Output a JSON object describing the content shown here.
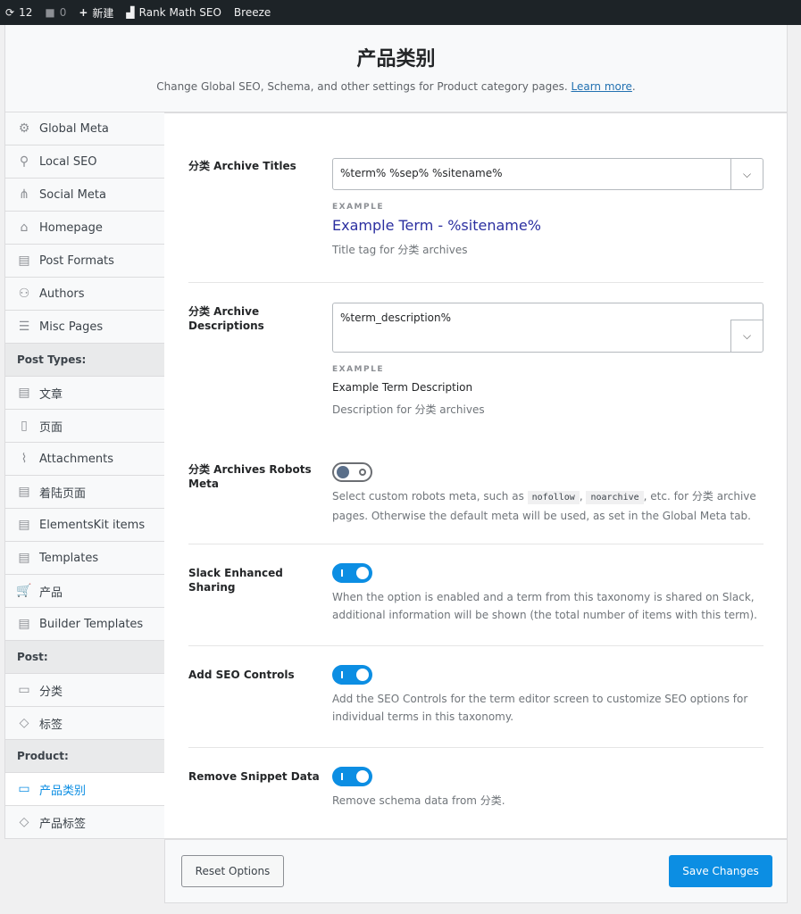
{
  "topbar": {
    "updates": "12",
    "comments": "0",
    "new": "新建",
    "rankmath": "Rank Math SEO",
    "breeze": "Breeze"
  },
  "header": {
    "title": "产品类别",
    "subtitle": "Change Global SEO, Schema, and other settings for Product category pages.",
    "learn_more": "Learn more",
    "period": "."
  },
  "sidebar": {
    "items": [
      {
        "label": "Global Meta",
        "icon": "⚙"
      },
      {
        "label": "Local SEO",
        "icon": "⚲"
      },
      {
        "label": "Social Meta",
        "icon": "⋔"
      },
      {
        "label": "Homepage",
        "icon": "⌂"
      },
      {
        "label": "Post Formats",
        "icon": "▤"
      },
      {
        "label": "Authors",
        "icon": "⚇"
      },
      {
        "label": "Misc Pages",
        "icon": "☰"
      },
      {
        "label": "Post Types:",
        "header": true
      },
      {
        "label": "文章",
        "icon": "▤"
      },
      {
        "label": "页面",
        "icon": "▯"
      },
      {
        "label": "Attachments",
        "icon": "⌇"
      },
      {
        "label": "着陆页面",
        "icon": "▤"
      },
      {
        "label": "ElementsKit items",
        "icon": "▤"
      },
      {
        "label": "Templates",
        "icon": "▤"
      },
      {
        "label": "产品",
        "icon": "🛒"
      },
      {
        "label": "Builder Templates",
        "icon": "▤"
      },
      {
        "label": "Post:",
        "header": true
      },
      {
        "label": "分类",
        "icon": "▭"
      },
      {
        "label": "标签",
        "icon": "◇"
      },
      {
        "label": "Product:",
        "header": true
      },
      {
        "label": "产品类别",
        "icon": "▭",
        "active": true
      },
      {
        "label": "产品标签",
        "icon": "◇"
      }
    ]
  },
  "settings": {
    "titles": {
      "label": "分类 Archive Titles",
      "value": "%term% %sep% %sitename%",
      "example_label": "EXAMPLE",
      "example": "Example Term - %sitename%",
      "desc": "Title tag for 分类 archives"
    },
    "descriptions": {
      "label": "分类 Archive Descriptions",
      "value": "%term_description%",
      "example_label": "EXAMPLE",
      "example": "Example Term Description",
      "desc": "Description for 分类 archives"
    },
    "robots": {
      "label": "分类 Archives Robots Meta",
      "enabled": false,
      "desc_a": "Select custom robots meta, such as ",
      "code1": "nofollow",
      "sep": ", ",
      "code2": "noarchive",
      "desc_b": ", etc. for 分类 archive pages. Otherwise the default meta will be used, as set in the Global Meta tab."
    },
    "slack": {
      "label": "Slack Enhanced Sharing",
      "enabled": true,
      "desc": "When the option is enabled and a term from this taxonomy is shared on Slack, additional information will be shown (the total number of items with this term)."
    },
    "seo_controls": {
      "label": "Add SEO Controls",
      "enabled": true,
      "desc": "Add the SEO Controls for the term editor screen to customize SEO options for individual terms in this taxonomy."
    },
    "snippet": {
      "label": "Remove Snippet Data",
      "enabled": true,
      "desc": "Remove schema data from 分类."
    }
  },
  "footer": {
    "reset": "Reset Options",
    "save": "Save Changes"
  },
  "colors": {
    "accent": "#0c8ee3",
    "example_link": "#2b2fa0"
  }
}
